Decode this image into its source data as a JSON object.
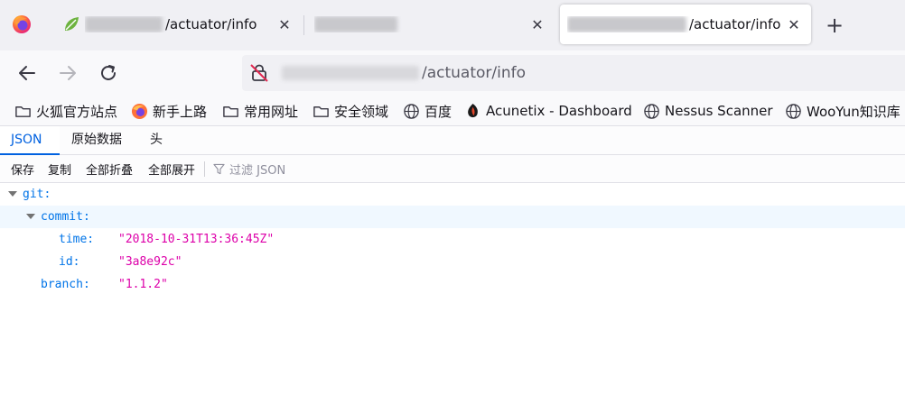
{
  "tabs": [
    {
      "title_suffix": "/actuator/info",
      "close_glyph": "✕",
      "active": false,
      "favicon": "spring-leaf-icon"
    },
    {
      "title_suffix": "",
      "close_glyph": "✕",
      "active": false,
      "favicon": "blank-icon"
    },
    {
      "title_suffix": "/actuator/info",
      "close_glyph": "✕",
      "active": true,
      "favicon": "none"
    }
  ],
  "new_tab_glyph": "+",
  "address_bar": {
    "path": "/actuator/info",
    "security_icon": "insecure-lock-icon"
  },
  "bookmarks": [
    {
      "label": "火狐官方站点",
      "icon": "folder-icon"
    },
    {
      "label": "新手上路",
      "icon": "firefox-icon"
    },
    {
      "label": "常用网址",
      "icon": "folder-icon"
    },
    {
      "label": "安全领域",
      "icon": "folder-icon"
    },
    {
      "label": "百度",
      "icon": "globe-icon"
    },
    {
      "label": "Acunetix - Dashboard",
      "icon": "acunetix-icon"
    },
    {
      "label": "Nessus Scanner",
      "icon": "globe-icon"
    },
    {
      "label": "WooYun知识库",
      "icon": "globe-icon"
    }
  ],
  "viewer_tabs": [
    "JSON",
    "原始数据",
    "头"
  ],
  "toolbar": {
    "save": "保存",
    "copy": "复制",
    "collapse_all": "全部折叠",
    "expand_all": "全部展开",
    "filter_placeholder": "过滤 JSON"
  },
  "tree": {
    "git_key": "git:",
    "commit_key": "commit:",
    "time_key": "time:",
    "time_value": "\"2018-10-31T13:36:45Z\"",
    "id_key": "id:",
    "id_value": "\"3a8e92c\"",
    "branch_key": "branch:",
    "branch_value": "\"1.1.2\""
  },
  "colors": {
    "accent": "#0061e0",
    "json_key": "#0074e8",
    "json_string": "#dd00a9",
    "firefox_orange": "#ff7139"
  }
}
